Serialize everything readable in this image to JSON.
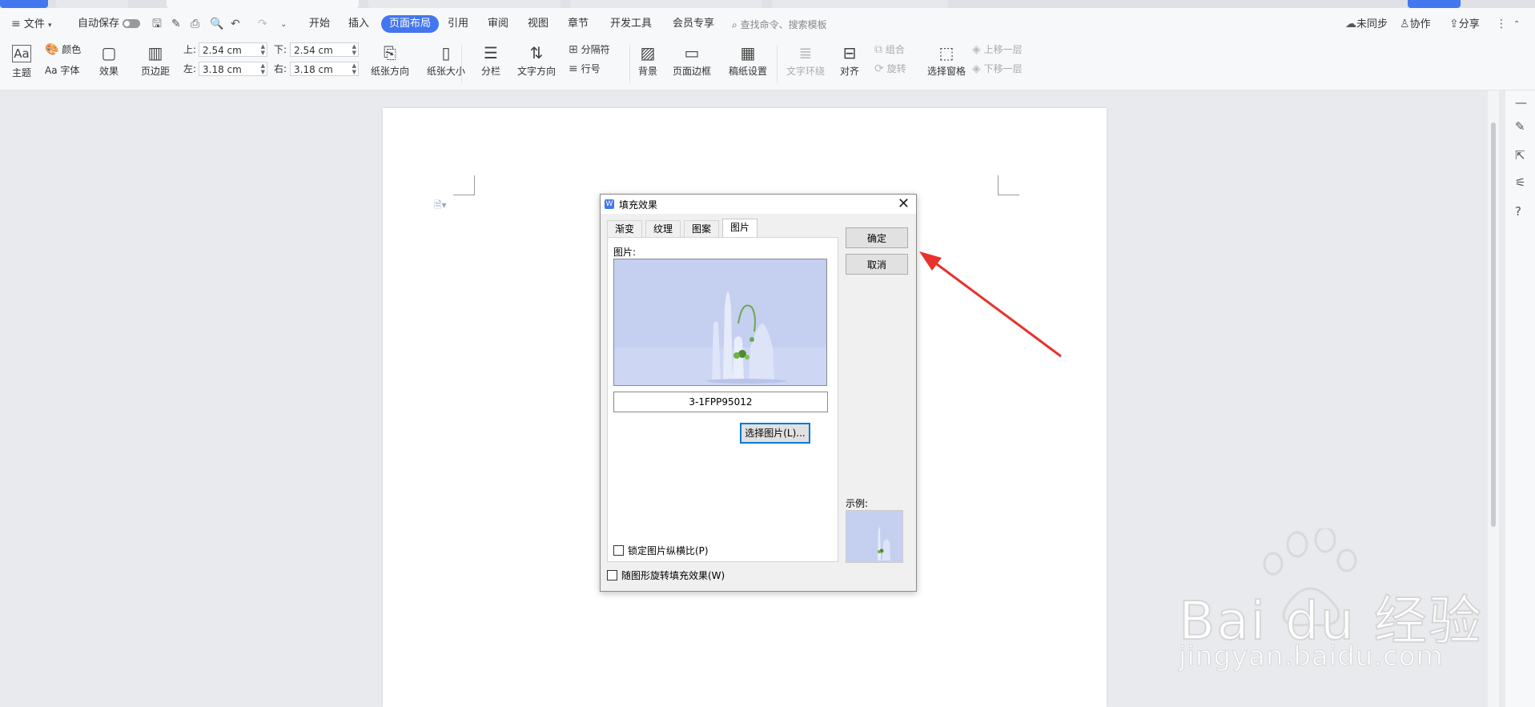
{
  "menubar": {
    "file": "文件",
    "autosave": "自动保存",
    "tabs": [
      "开始",
      "插入",
      "页面布局",
      "引用",
      "审阅",
      "视图",
      "章节",
      "开发工具",
      "会员专享"
    ],
    "active_tab": "页面布局",
    "search_placeholder": "查找命令、搜索模板",
    "right": [
      "未同步",
      "协作",
      "分享"
    ]
  },
  "ribbon": {
    "theme": "主题",
    "color": "颜色",
    "font": "Aa 字体",
    "effect": "效果",
    "margins": "页边距",
    "top_label": "上:",
    "top_value": "2.54 cm",
    "bottom_label": "下:",
    "bottom_value": "2.54 cm",
    "left_label": "左:",
    "left_value": "3.18 cm",
    "right_label": "右:",
    "right_value": "3.18 cm",
    "orientation": "纸张方向",
    "size": "纸张大小",
    "columns": "分栏",
    "text_direction": "文字方向",
    "breaks": "分隔符",
    "line_numbers": "行号",
    "background": "背景",
    "page_border": "页面边框",
    "manuscript": "稿纸设置",
    "wrap_text": "文字环绕",
    "align": "对齐",
    "group": "组合",
    "rotate": "旋转",
    "selection_pane": "选择窗格",
    "bring_forward": "上移一层",
    "send_backward": "下移一层"
  },
  "dialog": {
    "title": "填充效果",
    "tabs": [
      "渐变",
      "纹理",
      "图案",
      "图片"
    ],
    "active_tab": "图片",
    "picture_label": "图片:",
    "file_name": "3-1FPP95012",
    "select_button": "选择图片(L)...",
    "ok": "确定",
    "cancel": "取消",
    "sample_label": "示例:",
    "lock_aspect": "锁定图片纵横比(P)",
    "rotate_with_shape": "随图形旋转填充效果(W)"
  },
  "watermark": {
    "brand": "Bai du 经验",
    "url": "jingyan.baidu.com"
  },
  "colors": {
    "accent": "#4377f0",
    "arrow": "#e8322b",
    "image_bg": "#c5cff0"
  }
}
